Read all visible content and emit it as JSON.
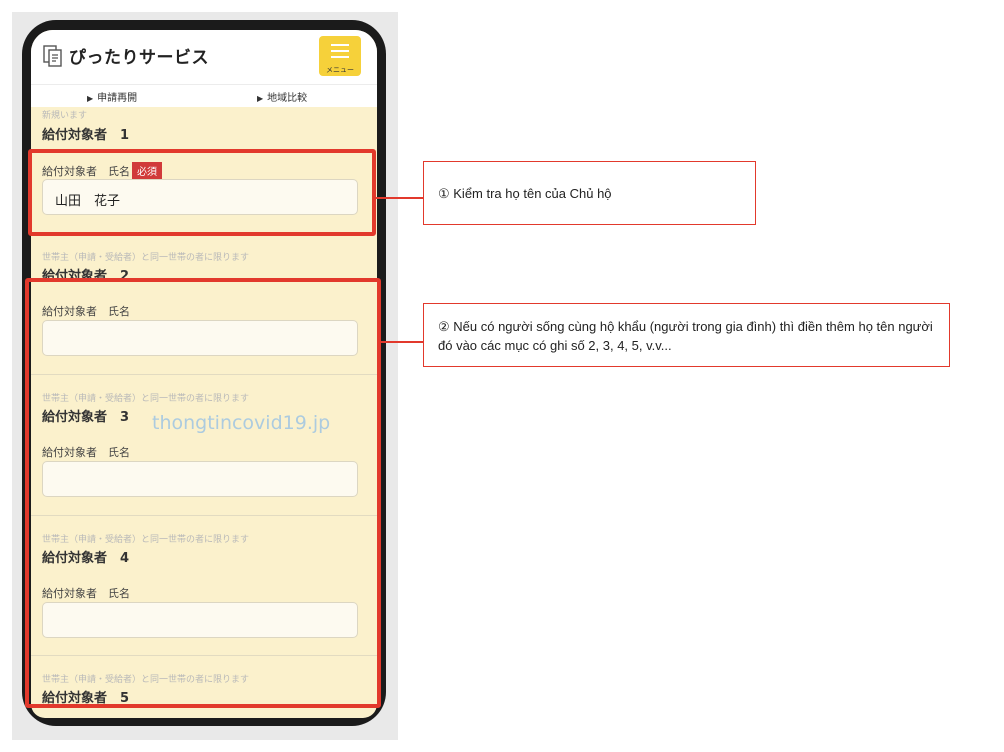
{
  "app": {
    "title": "ぴったりサービス",
    "menu_label": "メニュー"
  },
  "subnav": {
    "resume": "申請再開",
    "compare": "地域比較"
  },
  "sections": [
    {
      "note": "新規います",
      "title": "給付対象者　1",
      "label": "給付対象者　氏名",
      "required": "必須",
      "value": "山田　花子"
    },
    {
      "note": "世帯主（申請・受給者）と同一世帯の者に限ります",
      "title": "給付対象者　2",
      "label": "給付対象者　氏名",
      "value": ""
    },
    {
      "note": "世帯主（申請・受給者）と同一世帯の者に限ります",
      "title": "給付対象者　3",
      "label": "給付対象者　氏名",
      "value": ""
    },
    {
      "note": "世帯主（申請・受給者）と同一世帯の者に限ります",
      "title": "給付対象者　4",
      "label": "給付対象者　氏名",
      "value": ""
    },
    {
      "note": "世帯主（申請・受給者）と同一世帯の者に限ります",
      "title": "給付対象者　5"
    }
  ],
  "watermark": "thongtincovid19.jp",
  "annotations": {
    "note1": "① Kiểm tra họ tên của Chủ hộ",
    "note2": "② Nếu có người sống cùng hộ khẩu (người trong gia đình) thì điền thêm họ tên người đó vào các mục có ghi số 2, 3, 4, 5, v.v..."
  },
  "colors": {
    "highlight": "#e2392c",
    "screen_bg": "#fbf1cc",
    "menu_button": "#f6d13a",
    "required_badge": "#d13a3a"
  },
  "icons": {
    "logo": "document-icon",
    "menu": "hamburger-icon",
    "subnav_marker": "triangle-right-icon"
  }
}
